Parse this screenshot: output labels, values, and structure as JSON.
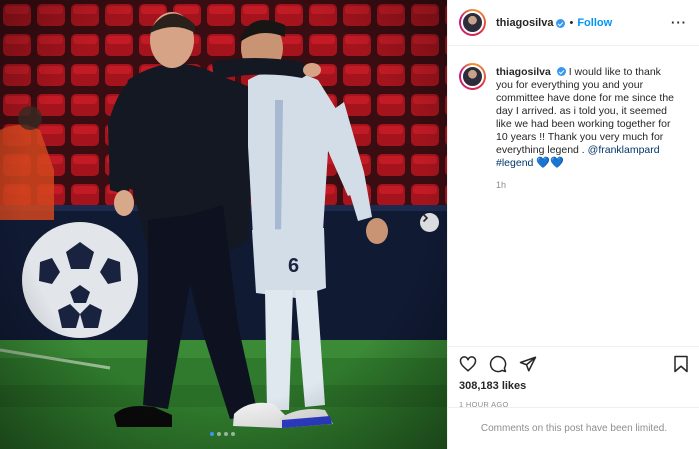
{
  "header": {
    "username": "thiagosilva",
    "separator": "•",
    "follow_label": "Follow",
    "more_label": "···"
  },
  "caption": {
    "username": "thiagosilva",
    "text": "I would like to thank you for everything you and your committee have done for me since the day I arrived. as i told you, it seemed like we had been working together for 10 years !! Thank you very much for everything legend .",
    "mention": "@franklampard",
    "hashtag": "#legend",
    "emoji": "💙💙",
    "time": "1h"
  },
  "post": {
    "likes": "308,183 likes",
    "posted_ago": "1 HOUR AGO",
    "comments_notice": "Comments on this post have been limited."
  },
  "carousel": {
    "slide_count": 4,
    "active_slide": 1
  },
  "colors": {
    "accent": "#0095f6",
    "verified": "#3897f0",
    "photo_bg": "#1b2230",
    "pitch": "#2f7a2c"
  },
  "icons": {
    "like": "heart-icon",
    "comment": "comment-icon",
    "share": "paper-plane-icon",
    "save": "bookmark-icon",
    "next": "chevron-right-icon"
  }
}
